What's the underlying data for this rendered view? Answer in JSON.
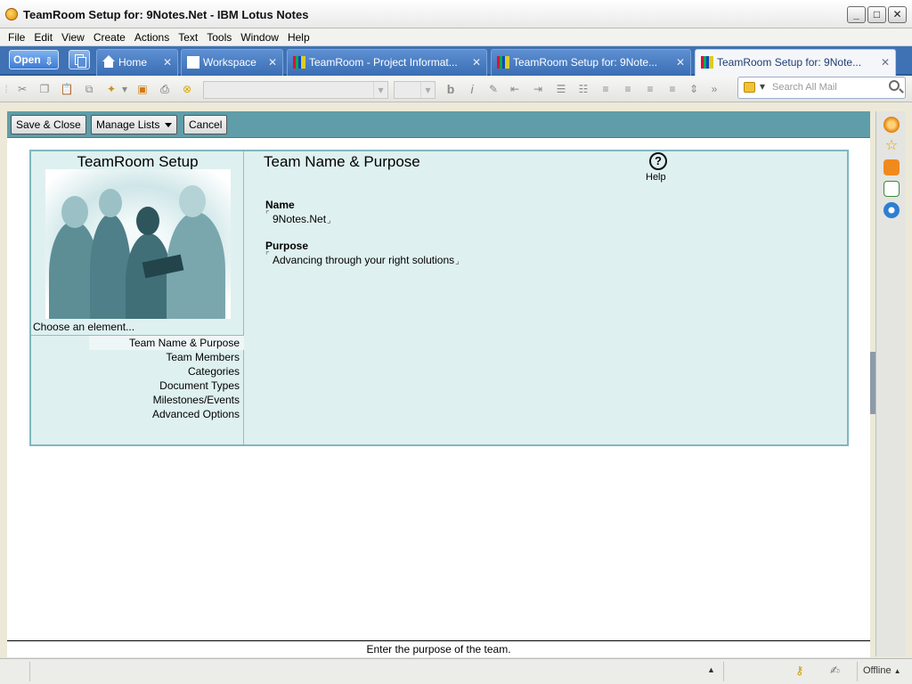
{
  "window": {
    "title": "TeamRoom Setup for: 9Notes.Net - IBM Lotus Notes"
  },
  "menu": [
    "File",
    "Edit",
    "View",
    "Create",
    "Actions",
    "Text",
    "Tools",
    "Window",
    "Help"
  ],
  "tabs": {
    "open_label": "Open",
    "items": [
      {
        "label": "Home",
        "icon": "home-icon"
      },
      {
        "label": "Workspace",
        "icon": "workspace-icon"
      },
      {
        "label": "TeamRoom - Project Informat...",
        "icon": "teamroom-icon"
      },
      {
        "label": "TeamRoom Setup for: 9Note...",
        "icon": "teamroom-icon"
      },
      {
        "label": "TeamRoom Setup for: 9Note...",
        "icon": "teamroom-icon",
        "active": true
      }
    ]
  },
  "search": {
    "placeholder": "Search All Mail"
  },
  "actions": {
    "save_close": "Save & Close",
    "manage_lists": "Manage Lists",
    "cancel": "Cancel"
  },
  "left": {
    "title": "TeamRoom Setup",
    "choose_label": "Choose an element...",
    "nav": [
      "Team Name & Purpose",
      "Team Members",
      "Categories",
      "Document Types",
      "Milestones/Events",
      "Advanced Options"
    ]
  },
  "main": {
    "heading": "Team Name & Purpose",
    "help_label": "Help",
    "name_label": "Name",
    "name_value": "9Notes.Net",
    "purpose_label": "Purpose",
    "purpose_value": "Advancing through your right solutions"
  },
  "status_hint": "Enter the purpose of the team.",
  "bottom": {
    "offline_label": "Offline"
  },
  "colors": {
    "tabbar": "#3f72b4",
    "actionbar": "#5f9ea9",
    "panel": "#dff0f0"
  }
}
